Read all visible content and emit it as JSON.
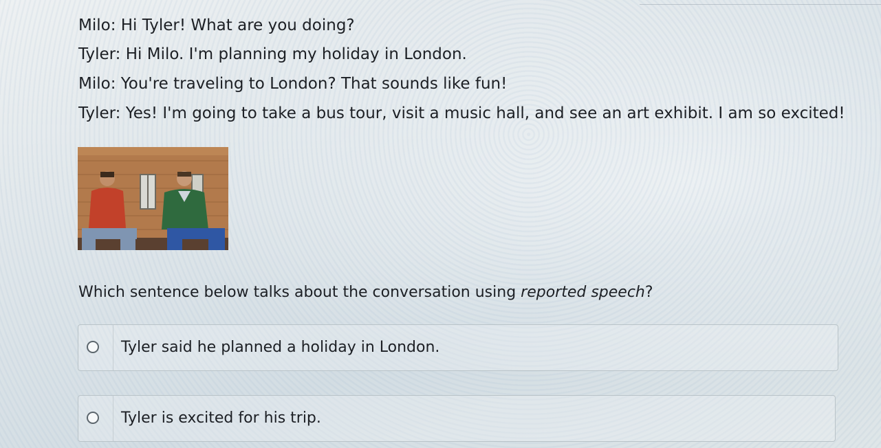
{
  "dialogue": [
    {
      "speaker": "Milo",
      "text": "Milo: Hi Tyler! What are you doing?"
    },
    {
      "speaker": "Tyler",
      "text": "Tyler: Hi Milo. I'm planning my holiday in London."
    },
    {
      "speaker": "Milo",
      "text": "Milo: You're traveling to London? That sounds like fun!"
    },
    {
      "speaker": "Tyler",
      "text": "Tyler: Yes! I'm going to take a bus tour, visit a music hall, and see an art exhibit. I am so excited!"
    }
  ],
  "photo": {
    "icon": "photo-two-men-sitting-on-bench"
  },
  "question": {
    "prefix": "Which sentence below talks about the conversation using ",
    "emphasis": "reported speech",
    "suffix": "?"
  },
  "options": [
    {
      "label": "Tyler said he planned a holiday in London.",
      "selected": false
    },
    {
      "label": "Tyler is excited for his trip.",
      "selected": false
    }
  ]
}
